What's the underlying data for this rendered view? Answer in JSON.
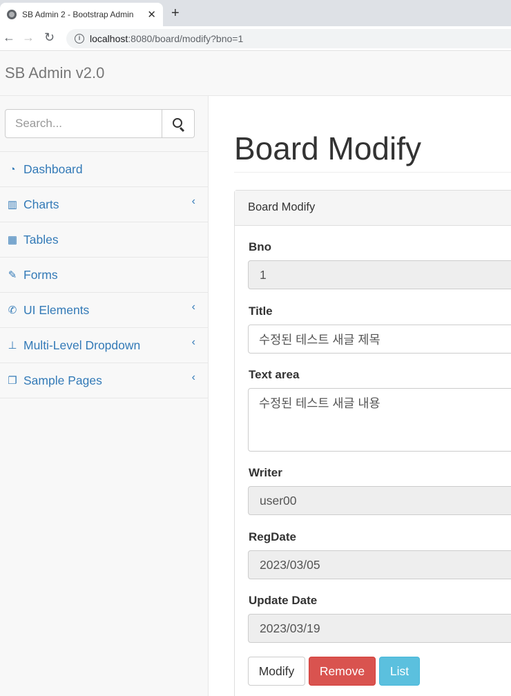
{
  "browser": {
    "tab_title": "SB Admin 2 - Bootstrap Admin",
    "new_tab": "+",
    "url_host": "localhost",
    "url_rest": ":8080/board/modify?bno=1"
  },
  "navbar": {
    "brand": "SB Admin v2.0"
  },
  "sidebar": {
    "search_placeholder": "Search...",
    "items": [
      {
        "label": "Dashboard",
        "icon": "dashboard-icon"
      },
      {
        "label": "Charts",
        "icon": "bar-chart-icon"
      },
      {
        "label": "Tables",
        "icon": "table-icon"
      },
      {
        "label": "Forms",
        "icon": "edit-icon"
      },
      {
        "label": "UI Elements",
        "icon": "wrench-icon"
      },
      {
        "label": "Multi-Level Dropdown",
        "icon": "sitemap-icon"
      },
      {
        "label": "Sample Pages",
        "icon": "files-icon"
      }
    ]
  },
  "main": {
    "page_title": "Board Modify",
    "panel_heading": "Board Modify",
    "fields": {
      "bno_label": "Bno",
      "bno_value": "1",
      "title_label": "Title",
      "title_value": "수정된 테스트 새글 제목",
      "content_label": "Text area",
      "content_value": "수정된 테스트 새글 내용",
      "writer_label": "Writer",
      "writer_value": "user00",
      "regdate_label": "RegDate",
      "regdate_value": "2023/03/05",
      "updatedate_label": "Update Date",
      "updatedate_value": "2023/03/19"
    },
    "buttons": {
      "modify": "Modify",
      "remove": "Remove",
      "list": "List"
    }
  },
  "colors": {
    "link": "#337ab7",
    "danger": "#d9534f",
    "info": "#5bc0de"
  }
}
